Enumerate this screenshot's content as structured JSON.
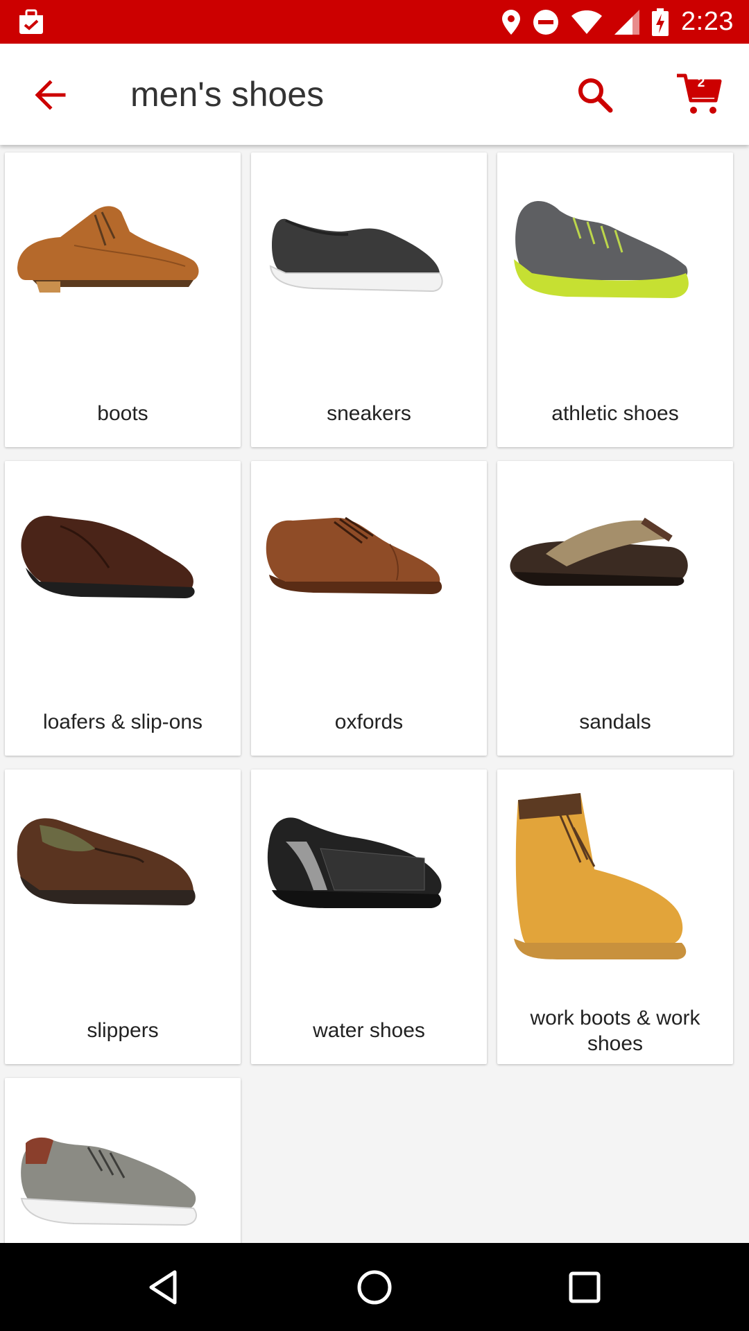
{
  "status_bar": {
    "time": "2:23",
    "icons": [
      "target-app-notification-icon",
      "location-icon",
      "do-not-disturb-icon",
      "wifi-icon",
      "signal-icon",
      "battery-charging-icon"
    ],
    "background": "#cc0000"
  },
  "app_bar": {
    "title": "men's shoes",
    "back_icon": "arrow-back-icon",
    "search_icon": "search-icon",
    "cart_icon": "cart-icon",
    "cart_count": "2",
    "accent": "#cc0000"
  },
  "categories": [
    {
      "label": "boots"
    },
    {
      "label": "sneakers"
    },
    {
      "label": "athletic shoes"
    },
    {
      "label": "loafers & slip-ons"
    },
    {
      "label": "oxfords"
    },
    {
      "label": "sandals"
    },
    {
      "label": "slippers"
    },
    {
      "label": "water shoes"
    },
    {
      "label": "work boots & work shoes"
    },
    {
      "label": ""
    }
  ],
  "nav_bar": {
    "back": "nav-back-icon",
    "home": "nav-home-icon",
    "recents": "nav-recents-icon"
  }
}
